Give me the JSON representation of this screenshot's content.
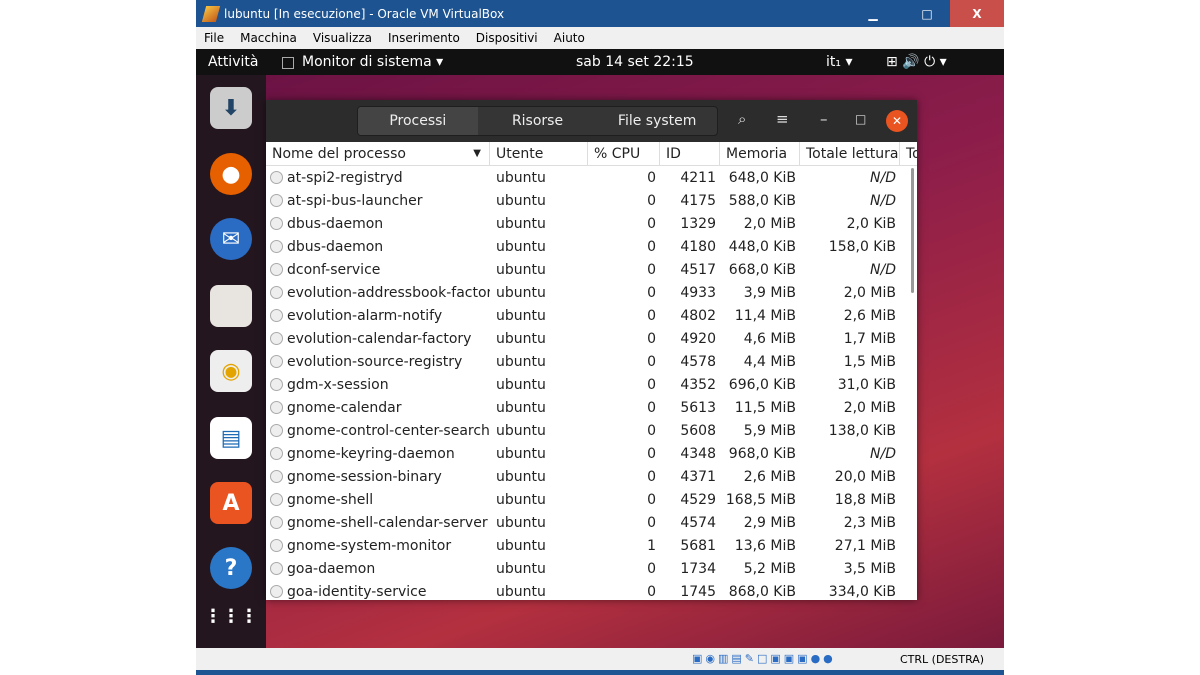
{
  "window": {
    "title": "lubuntu [In esecuzione] - Oracle VM VirtualBox",
    "min": "▁",
    "max": "□",
    "close": "X"
  },
  "menu": [
    "File",
    "Macchina",
    "Visualizza",
    "Inserimento",
    "Dispositivi",
    "Aiuto"
  ],
  "topbar": {
    "activities": "Attività",
    "app": "Monitor di sistema ▾",
    "clock": "sab 14 set  22:15",
    "lang": "it₁ ▾",
    "icons": "⊞  🔊  ⏻ ▾"
  },
  "statusbar": {
    "host_key": "CTRL (DESTRA)"
  },
  "app": {
    "tabs": [
      "Processi",
      "Risorse",
      "File system"
    ],
    "columns": [
      "Nome del processo",
      "Utente",
      "% CPU",
      "ID",
      "Memoria",
      "Totale lettura",
      "To"
    ],
    "sort_indicator": "▼",
    "rows": [
      [
        "at-spi2-registryd",
        "ubuntu",
        "0",
        "4211",
        "648,0 KiB",
        "N/D"
      ],
      [
        "at-spi-bus-launcher",
        "ubuntu",
        "0",
        "4175",
        "588,0 KiB",
        "N/D"
      ],
      [
        "dbus-daemon",
        "ubuntu",
        "0",
        "1329",
        "2,0 MiB",
        "2,0 KiB"
      ],
      [
        "dbus-daemon",
        "ubuntu",
        "0",
        "4180",
        "448,0 KiB",
        "158,0 KiB"
      ],
      [
        "dconf-service",
        "ubuntu",
        "0",
        "4517",
        "668,0 KiB",
        "N/D"
      ],
      [
        "evolution-addressbook-factory",
        "ubuntu",
        "0",
        "4933",
        "3,9 MiB",
        "2,0 MiB"
      ],
      [
        "evolution-alarm-notify",
        "ubuntu",
        "0",
        "4802",
        "11,4 MiB",
        "2,6 MiB"
      ],
      [
        "evolution-calendar-factory",
        "ubuntu",
        "0",
        "4920",
        "4,6 MiB",
        "1,7 MiB"
      ],
      [
        "evolution-source-registry",
        "ubuntu",
        "0",
        "4578",
        "4,4 MiB",
        "1,5 MiB"
      ],
      [
        "gdm-x-session",
        "ubuntu",
        "0",
        "4352",
        "696,0 KiB",
        "31,0 KiB"
      ],
      [
        "gnome-calendar",
        "ubuntu",
        "0",
        "5613",
        "11,5 MiB",
        "2,0 MiB"
      ],
      [
        "gnome-control-center-search-provider",
        "ubuntu",
        "0",
        "5608",
        "5,9 MiB",
        "138,0 KiB"
      ],
      [
        "gnome-keyring-daemon",
        "ubuntu",
        "0",
        "4348",
        "968,0 KiB",
        "N/D"
      ],
      [
        "gnome-session-binary",
        "ubuntu",
        "0",
        "4371",
        "2,6 MiB",
        "20,0 MiB"
      ],
      [
        "gnome-shell",
        "ubuntu",
        "0",
        "4529",
        "168,5 MiB",
        "18,8 MiB"
      ],
      [
        "gnome-shell-calendar-server",
        "ubuntu",
        "0",
        "4574",
        "2,9 MiB",
        "2,3 MiB"
      ],
      [
        "gnome-system-monitor",
        "ubuntu",
        "1",
        "5681",
        "13,6 MiB",
        "27,1 MiB"
      ],
      [
        "goa-daemon",
        "ubuntu",
        "0",
        "1734",
        "5,2 MiB",
        "3,5 MiB"
      ],
      [
        "goa-identity-service",
        "ubuntu",
        "0",
        "1745",
        "868,0 KiB",
        "334,0 KiB"
      ]
    ]
  },
  "colors": {
    "accent": "#e95420",
    "vbox_blue": "#1c5390"
  }
}
